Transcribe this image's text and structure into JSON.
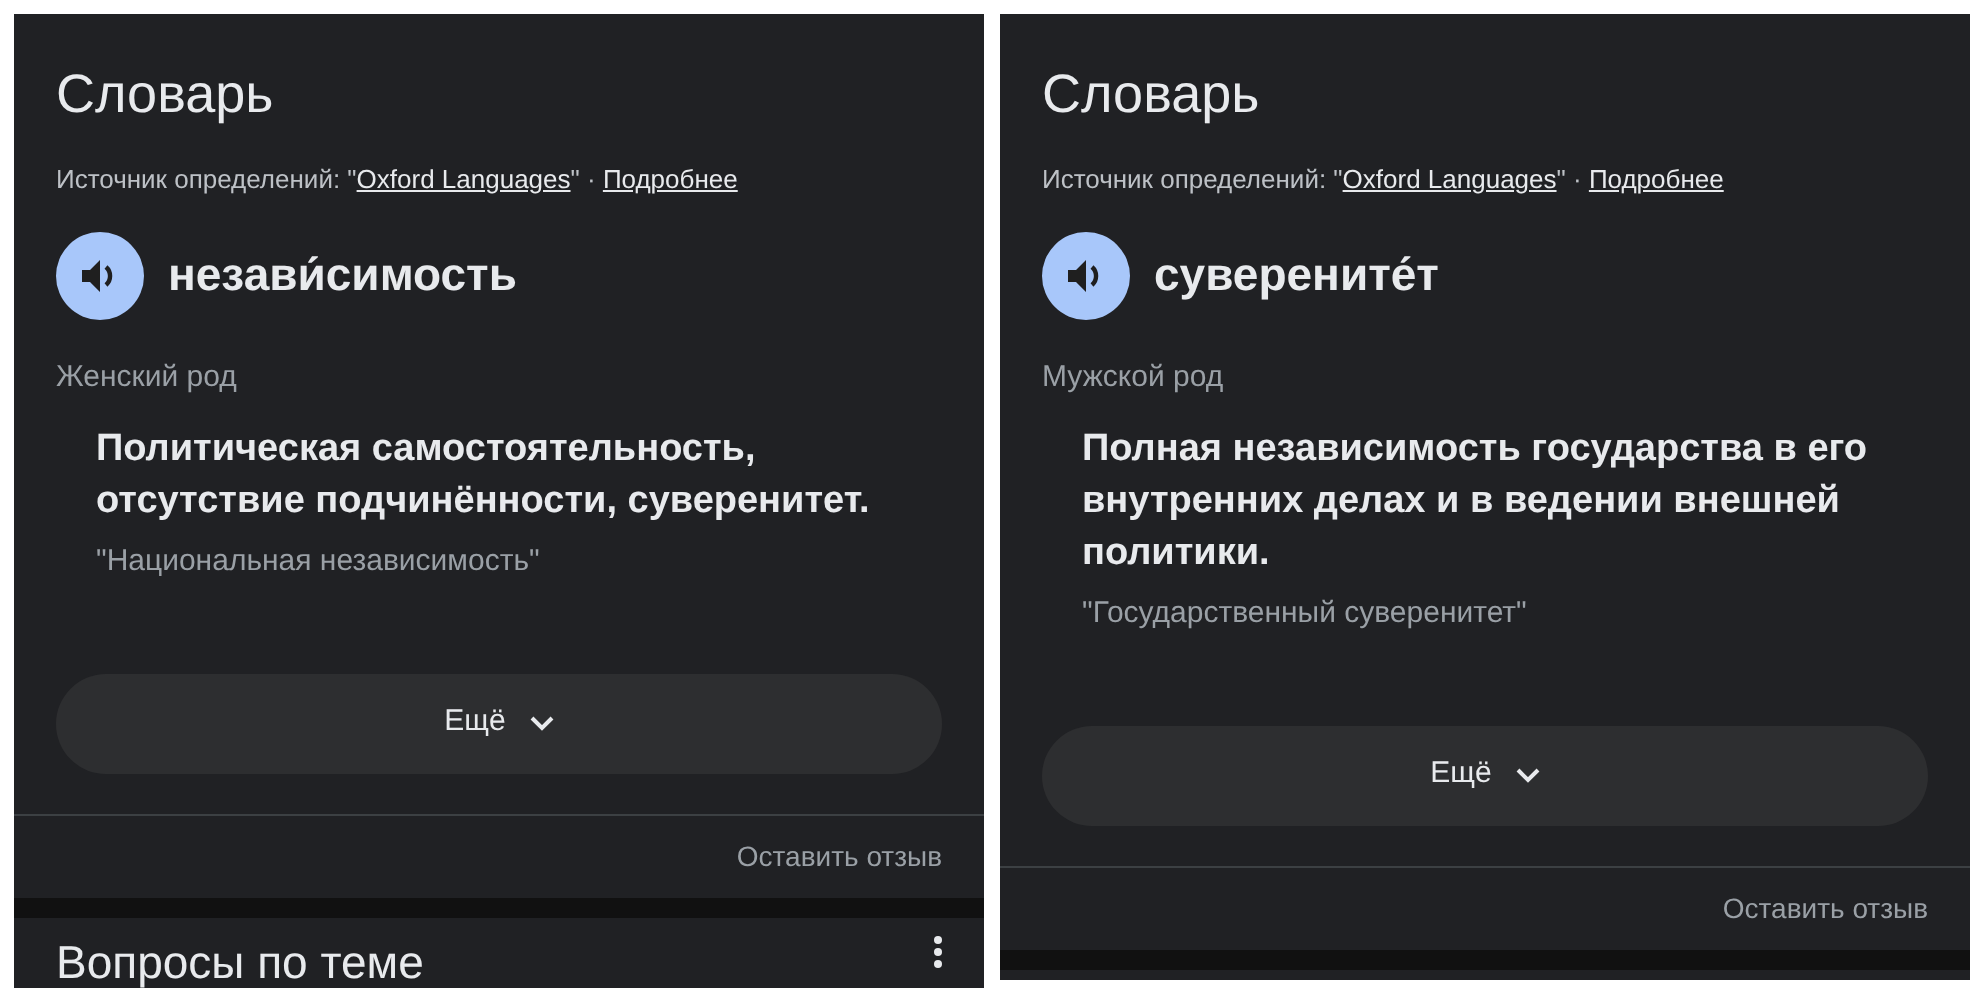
{
  "panels": [
    {
      "title": "Словарь",
      "source": {
        "prefix": "Источник определений: \"",
        "link": "Oxford Languages",
        "suffix": "\" ·",
        "more": "Подробнее"
      },
      "word": "незави́симость",
      "gender": "Женский род",
      "definition": "Политическая самостоятельность, отсутствие подчинённости, суверенитет.",
      "example": "\"Национальная независимость\"",
      "more_button": "Ещё",
      "feedback": "Оставить отзыв",
      "next_section": {
        "title": "Вопросы по теме"
      }
    },
    {
      "title": "Словарь",
      "source": {
        "prefix": "Источник определений: \"",
        "link": "Oxford Languages",
        "suffix": "\" ·",
        "more": "Подробнее"
      },
      "word": "суверените́т",
      "gender": "Мужской род",
      "definition": "Полная независимость государства в его внутренних делах и в ведении внешней политики.",
      "example": "\"Государственный суверенитет\"",
      "more_button": "Ещё",
      "feedback": "Оставить отзыв"
    }
  ]
}
